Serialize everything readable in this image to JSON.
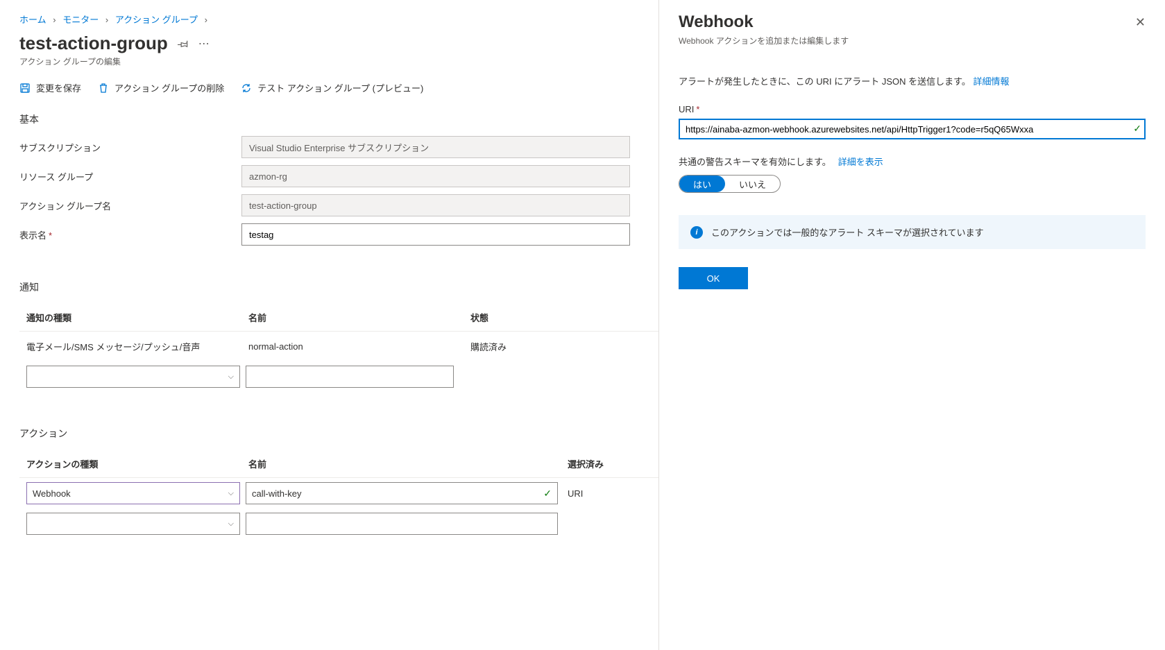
{
  "breadcrumb": [
    {
      "label": "ホーム"
    },
    {
      "label": "モニター"
    },
    {
      "label": "アクション グループ"
    }
  ],
  "page": {
    "title": "test-action-group",
    "subtitle": "アクション グループの編集"
  },
  "toolbar": {
    "save": "変更を保存",
    "delete": "アクション グループの削除",
    "test": "テスト アクション グループ (プレビュー)"
  },
  "basic": {
    "section": "基本",
    "subscription_label": "サブスクリプション",
    "subscription_value": "Visual Studio Enterprise サブスクリプション",
    "rg_label": "リソース グループ",
    "rg_value": "azmon-rg",
    "ag_label": "アクション グループ名",
    "ag_value": "test-action-group",
    "display_label": "表示名",
    "display_value": "testag"
  },
  "notify": {
    "section": "通知",
    "col_type": "通知の種類",
    "col_name": "名前",
    "col_state": "状態",
    "row1_type": "電子メール/SMS メッセージ/プッシュ/音声",
    "row1_name": "normal-action",
    "row1_state": "購読済み"
  },
  "actions": {
    "section": "アクション",
    "col_type": "アクションの種類",
    "col_name": "名前",
    "col_sel": "選択済み",
    "row1_type": "Webhook",
    "row1_name": "call-with-key",
    "row1_sel": "URI"
  },
  "panel": {
    "title": "Webhook",
    "subtitle": "Webhook アクションを追加または編集します",
    "desc": "アラートが発生したときに、この URI にアラート JSON を送信します。",
    "desc_link": "詳細情報",
    "uri_label": "URI",
    "uri_value": "https://ainaba-azmon-webhook.azurewebsites.net/api/HttpTrigger1?code=r5qQ65Wxxa",
    "schema_label": "共通の警告スキーマを有効にします。",
    "schema_link": "詳細を表示",
    "toggle_yes": "はい",
    "toggle_no": "いいえ",
    "info": "このアクションでは一般的なアラート スキーマが選択されています",
    "ok": "OK"
  }
}
